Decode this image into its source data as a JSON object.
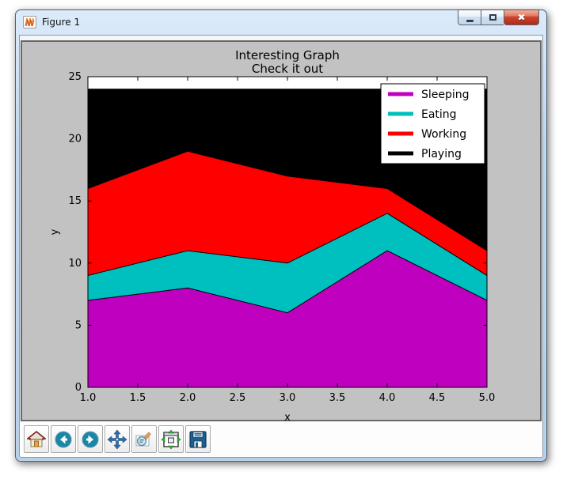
{
  "window": {
    "title": "Figure 1",
    "controls": [
      {
        "id": "minimize",
        "icon": "minimize-icon"
      },
      {
        "id": "maximize",
        "icon": "maximize-icon"
      },
      {
        "id": "close",
        "icon": "close-icon"
      }
    ]
  },
  "toolbar": {
    "buttons": [
      {
        "id": "home",
        "icon": "home-icon"
      },
      {
        "id": "back",
        "icon": "back-icon"
      },
      {
        "id": "forward",
        "icon": "forward-icon"
      },
      {
        "id": "pan",
        "icon": "pan-arrows-icon"
      },
      {
        "id": "zoom",
        "icon": "zoom-rect-icon"
      },
      {
        "id": "subplots",
        "icon": "configure-subplots-icon"
      },
      {
        "id": "save",
        "icon": "save-icon"
      }
    ]
  },
  "chart_data": {
    "type": "area",
    "stacked": true,
    "title_lines": [
      "Interesting Graph",
      "Check it out"
    ],
    "x": [
      1,
      2,
      3,
      4,
      5
    ],
    "series": [
      {
        "name": "Sleeping",
        "color": "#bf00bf",
        "values": [
          7,
          8,
          6,
          11,
          7
        ]
      },
      {
        "name": "Eating",
        "color": "#00bfbf",
        "values": [
          2,
          3,
          4,
          3,
          2
        ]
      },
      {
        "name": "Working",
        "color": "#ff0000",
        "values": [
          7,
          8,
          7,
          2,
          2
        ]
      },
      {
        "name": "Playing",
        "color": "#000000",
        "values": [
          8,
          5,
          7,
          8,
          13
        ]
      }
    ],
    "xlabel": "x",
    "ylabel": "y",
    "xlim": [
      1,
      5
    ],
    "ylim": [
      0,
      25
    ],
    "xticks": [
      1.0,
      1.5,
      2.0,
      2.5,
      3.0,
      3.5,
      4.0,
      4.5,
      5.0
    ],
    "xtick_labels": [
      "1.0",
      "1.5",
      "2.0",
      "2.5",
      "3.0",
      "3.5",
      "4.0",
      "4.5",
      "5.0"
    ],
    "yticks": [
      0,
      5,
      10,
      15,
      20,
      25
    ],
    "ytick_labels": [
      "0",
      "5",
      "10",
      "15",
      "20",
      "25"
    ],
    "legend_position": "upper right",
    "grid": false,
    "plot_background": "#ffffff",
    "figure_background": "#c2c2c2",
    "edge_color": "#000000"
  }
}
